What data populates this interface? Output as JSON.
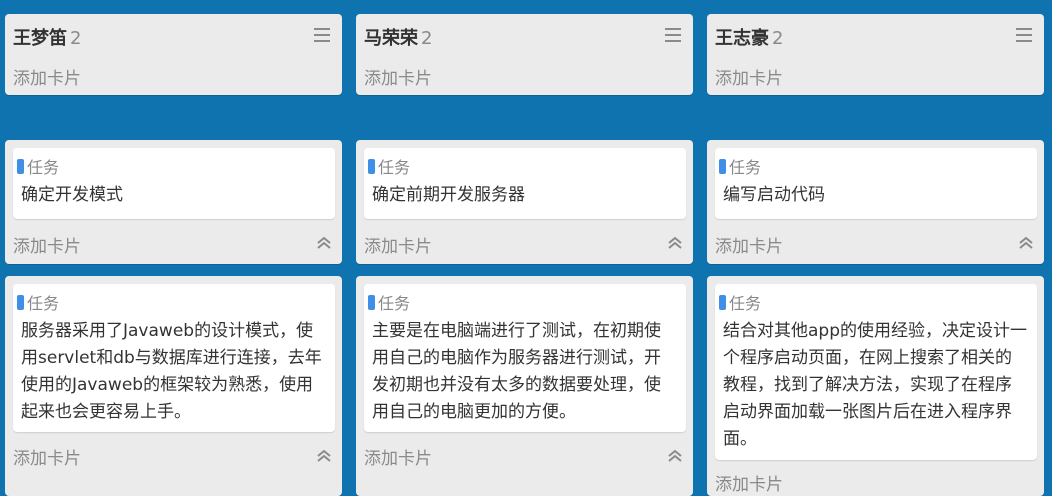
{
  "colors": {
    "background": "#0f73b0",
    "panel": "#ebebeb",
    "tag_accent": "#3f8fe6"
  },
  "columns": [
    {
      "member": {
        "name": "王梦笛",
        "count": "2",
        "add_label": "添加卡片"
      },
      "tasks": [
        {
          "tag": "任务",
          "text": "确定开发模式",
          "add_label": "添加卡片"
        },
        {
          "tag": "任务",
          "text": "服务器采用了Javaweb的设计模式，使用servlet和db与数据库进行连接，去年使用的Javaweb的框架较为熟悉，使用起来也会更容易上手。",
          "add_label": "添加卡片"
        }
      ]
    },
    {
      "member": {
        "name": "马荣荣",
        "count": "2",
        "add_label": "添加卡片"
      },
      "tasks": [
        {
          "tag": "任务",
          "text": "确定前期开发服务器",
          "add_label": "添加卡片"
        },
        {
          "tag": "任务",
          "text": "主要是在电脑端进行了测试，在初期使用自己的电脑作为服务器进行测试，开发初期也并没有太多的数据要处理，使用自己的电脑更加的方便。",
          "add_label": "添加卡片"
        }
      ]
    },
    {
      "member": {
        "name": "王志豪",
        "count": "2",
        "add_label": "添加卡片"
      },
      "tasks": [
        {
          "tag": "任务",
          "text": "编写启动代码",
          "add_label": "添加卡片"
        },
        {
          "tag": "任务",
          "text": "结合对其他app的使用经验，决定设计一个程序启动页面，在网上搜索了相关的教程，找到了解决方法，实现了在程序启动界面加载一张图片后在进入程序界面。",
          "add_label": "添加卡片"
        }
      ]
    }
  ]
}
